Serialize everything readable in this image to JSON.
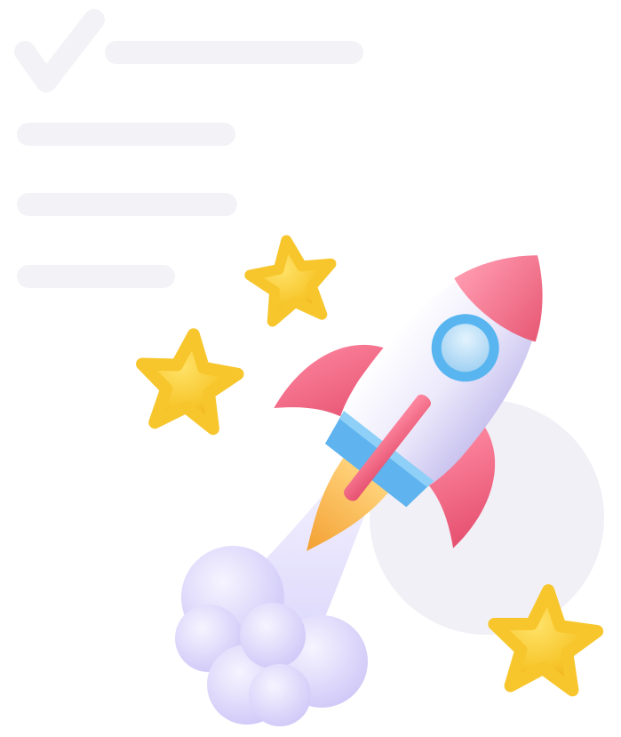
{
  "illustration": {
    "icons": [
      "checkmark-icon",
      "rocket-icon",
      "star-icon",
      "cloud-icon"
    ],
    "colors": {
      "placeholder_lines": "#f3f3f7",
      "backdrop_circle": "#f1f0f6",
      "rocket_body": "#ece9fb",
      "rocket_nose": "#f06e87",
      "rocket_fins": "#f06e87",
      "window_ring": "#58b5f0",
      "window_glass": "#b9def6",
      "rocket_band": "#5fb3ef",
      "flame": "#f8b24a",
      "exhaust_cloud": "#dcd7fb",
      "star": "#f7c62c"
    },
    "counts": {
      "checklist_lines": 4,
      "stars": 3,
      "cloud_puffs": 6
    }
  }
}
